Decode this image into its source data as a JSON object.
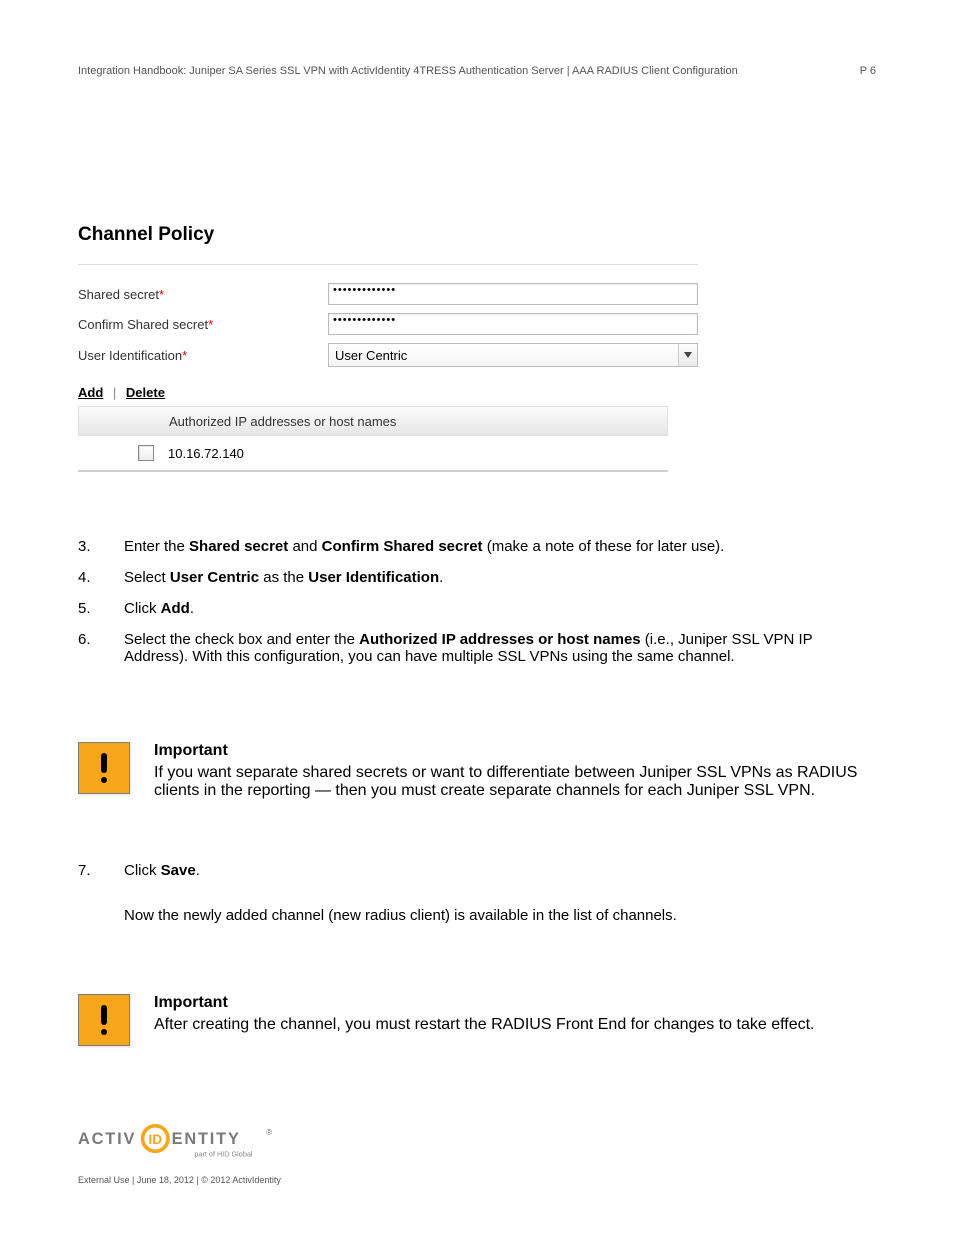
{
  "header": {
    "left": "Integration Handbook: Juniper SA Series SSL VPN with ActivIdentity 4TRESS Authentication Server | AAA RADIUS Client Configuration",
    "right": "P 6"
  },
  "card": {
    "title": "Channel Policy",
    "rows": {
      "shared": {
        "label": "Shared secret",
        "value": "•••••••••••••"
      },
      "confirm": {
        "label": "Confirm Shared secret",
        "value": "•••••••••••••"
      },
      "userid": {
        "label": "User Identification",
        "selected": "User Centric"
      }
    },
    "actions": {
      "add": "Add",
      "delete": "Delete"
    },
    "table": {
      "header": "Authorized IP addresses or host names",
      "ip": "10.16.72.140"
    }
  },
  "steps_a": {
    "s3": {
      "num": "3.",
      "text_a": "Enter the ",
      "b1": "Shared secret",
      "text_b": " and ",
      "b2": "Confirm Shared secret",
      "text_c": " (make a note of these for later use)."
    },
    "s4": {
      "num": "4.",
      "text_a": "Select ",
      "b1": "User Centric",
      "text_b": " as the ",
      "b2": "User Identification",
      "text_c": "."
    },
    "s5": {
      "num": "5.",
      "text_a": "Click ",
      "b1": "Add",
      "text_b": "."
    },
    "s6": {
      "num": "6.",
      "text_a": "Select the check box and enter the ",
      "b1": "Authorized IP addresses or host names",
      "text_b": " (i.e., Juniper SSL VPN IP Address). With this configuration, you can have multiple SSL VPNs using the same channel."
    }
  },
  "callout1": {
    "title": "Important",
    "text_a": "If you want separate shared secrets or want to differentiate between Juniper SSL VPNs as RADIUS clients in the reporting — then you must create separate channels for each Juniper SSL VPN."
  },
  "steps_b": {
    "s7": {
      "num": "7.",
      "text_a": "Click ",
      "b1": "Save",
      "text_b": "."
    },
    "extra": "Now the newly added channel (new radius client) is available in the list of channels."
  },
  "callout2": {
    "title": "Important",
    "text": "After creating the channel, you must restart the RADIUS Front End for changes to take effect."
  },
  "footer": {
    "logo_l": "ACTIV",
    "logo_r": "ENTITY",
    "reg": "®",
    "sub": "part of HID Global",
    "line_l": "External Use | June 18, 2012 | © 2012 ActivIdentity",
    "line_r": ""
  }
}
